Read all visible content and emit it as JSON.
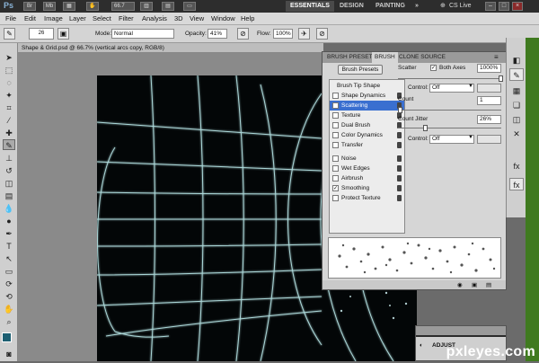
{
  "appbar": {
    "logo": "Ps",
    "zoom": "66.7",
    "workspaces": [
      "ESSENTIALS",
      "DESIGN",
      "PAINTING"
    ],
    "more": "»",
    "cs_live": "CS Live"
  },
  "menu": [
    "File",
    "Edit",
    "Image",
    "Layer",
    "Select",
    "Filter",
    "Analysis",
    "3D",
    "View",
    "Window",
    "Help"
  ],
  "options": {
    "brush_size": "26",
    "mode_label": "Mode:",
    "mode_value": "Normal",
    "opacity_label": "Opacity:",
    "opacity_value": "41%",
    "flow_label": "Flow:",
    "flow_value": "100%"
  },
  "document": {
    "tab_title": "Shape & Grid.psd @ 66.7% (vertical arcs copy, RGB/8)"
  },
  "brush_panel": {
    "tabs": [
      "BRUSH PRESETS",
      "BRUSH",
      "CLONE SOURCE"
    ],
    "presets_button": "Brush Presets",
    "header_item": "Brush Tip Shape",
    "items": [
      {
        "label": "Shape Dynamics",
        "checked": false
      },
      {
        "label": "Scattering",
        "checked": true
      },
      {
        "label": "Texture",
        "checked": false
      },
      {
        "label": "Dual Brush",
        "checked": false
      },
      {
        "label": "Color Dynamics",
        "checked": false
      },
      {
        "label": "Transfer",
        "checked": false
      },
      {
        "label": "Noise",
        "checked": false
      },
      {
        "label": "Wet Edges",
        "checked": false
      },
      {
        "label": "Airbrush",
        "checked": false
      },
      {
        "label": "Smoothing",
        "checked": true
      },
      {
        "label": "Protect Texture",
        "checked": false
      }
    ],
    "scatter_label": "Scatter",
    "both_axes_label": "Both Axes",
    "scatter_value": "1000%",
    "control_label": "Control:",
    "control_value": "Off",
    "count_label": "Count",
    "count_value": "1",
    "count_jitter_label": "Count Jitter",
    "count_jitter_value": "26%",
    "control2_value": "Off"
  },
  "adjustments": {
    "label": "ADJUST"
  },
  "watermark": "pxleyes.com",
  "colors": {
    "appbar": "#2d2d2d",
    "selected": "#3a6fd0",
    "canvas": "#030607",
    "glow": "#bfeff0",
    "dock_green": "#3f7a1f"
  }
}
